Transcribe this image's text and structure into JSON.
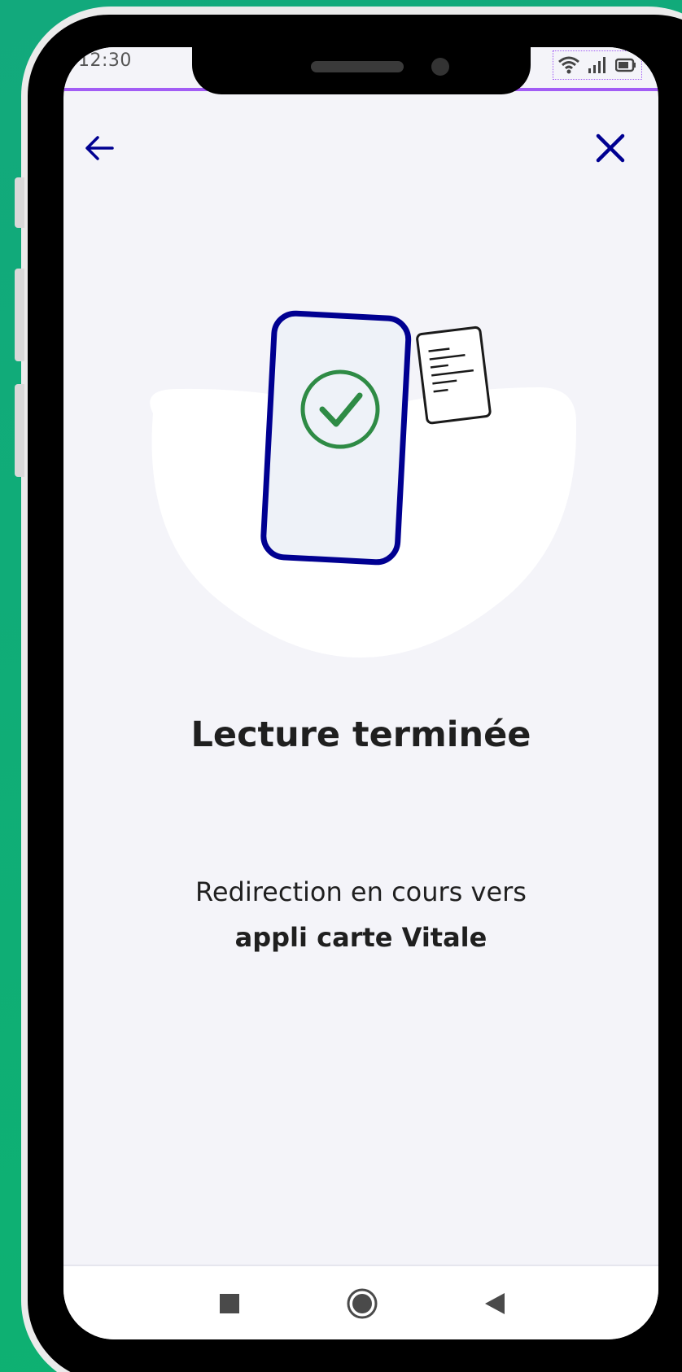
{
  "status_bar": {
    "time": "12:30",
    "icons": [
      "wifi-icon",
      "signal-icon",
      "battery-icon"
    ]
  },
  "navigation": {
    "back_icon": "arrow-left-icon",
    "close_icon": "close-icon"
  },
  "content": {
    "title": "Lecture terminée",
    "message_line1": "Redirection en cours vers",
    "message_line2": "appli carte Vitale"
  },
  "illustration": {
    "description_icons": [
      "phone-icon",
      "check-circle-icon",
      "card-icon"
    ]
  },
  "system_nav": {
    "buttons": [
      "recents-square-icon",
      "home-circle-icon",
      "back-triangle-icon"
    ]
  },
  "colors": {
    "background": "#10ae78",
    "screen_bg": "#f4f4f9",
    "accent_purple": "#a25cf5",
    "brand_navy": "#000091",
    "success_green": "#2e8b45",
    "text": "#1f1f1f"
  }
}
